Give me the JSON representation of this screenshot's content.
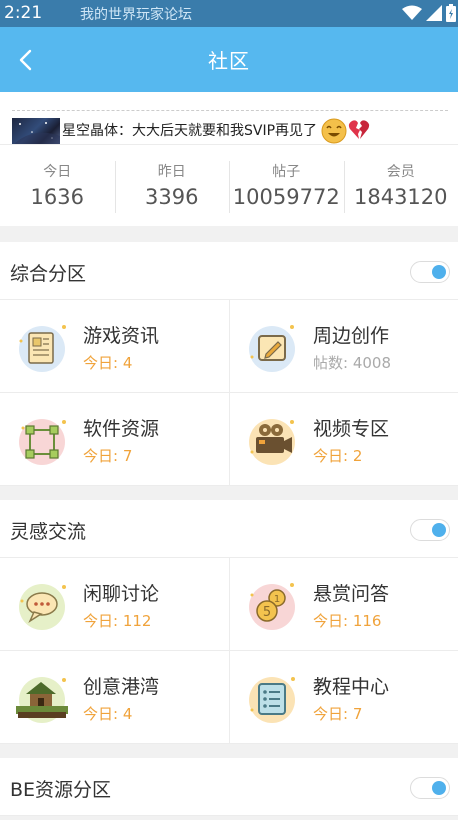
{
  "status_bar": {
    "time": "2:21",
    "title": "我的世界玩家论坛"
  },
  "app_bar": {
    "title": "社区"
  },
  "ticker": {
    "text": "星空晶体：大大后天就要和我SVIP再见了"
  },
  "stats": [
    {
      "label": "今日",
      "value": "1636"
    },
    {
      "label": "昨日",
      "value": "3396"
    },
    {
      "label": "帖子",
      "value": "10059772"
    },
    {
      "label": "会员",
      "value": "1843120"
    }
  ],
  "sections": [
    {
      "title": "综合分区",
      "toggle_on": true,
      "items": [
        {
          "name": "游戏资讯",
          "sub": "今日: 4",
          "icon": "newspaper-icon"
        },
        {
          "name": "周边创作",
          "sub": "帖数: 4008",
          "icon": "edit-icon"
        },
        {
          "name": "软件资源",
          "sub": "今日: 7",
          "icon": "nodes-icon"
        },
        {
          "name": "视频专区",
          "sub": "今日: 2",
          "icon": "video-camera-icon"
        }
      ]
    },
    {
      "title": "灵感交流",
      "toggle_on": true,
      "items": [
        {
          "name": "闲聊讨论",
          "sub": "今日: 112",
          "icon": "chat-bubble-icon"
        },
        {
          "name": "悬赏问答",
          "sub": "今日: 116",
          "icon": "coins-icon"
        },
        {
          "name": "创意港湾",
          "sub": "今日: 4",
          "icon": "pixel-house-icon"
        },
        {
          "name": "教程中心",
          "sub": "今日: 7",
          "icon": "list-icon"
        }
      ]
    },
    {
      "title": "BE资源分区",
      "toggle_on": true,
      "items": []
    }
  ],
  "colors": {
    "status_bar": "#3a7cab",
    "app_bar": "#56b8ef",
    "accent_orange": "#f0a33b",
    "toggle_blue": "#4fb0ec"
  }
}
